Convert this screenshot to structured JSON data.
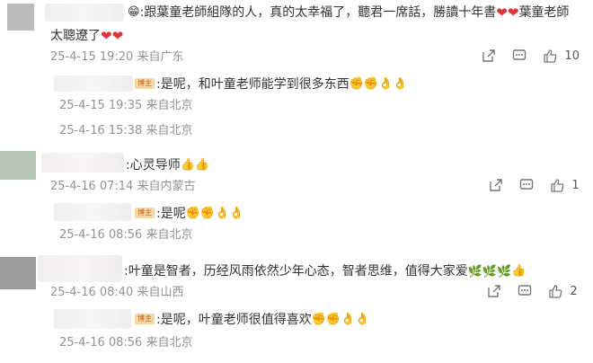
{
  "comments": [
    {
      "text_line1": ":跟葉童老師組隊的人，真的太幸福了，聽君一席話，勝讀十年書",
      "text_line1_tail": "葉童老師",
      "text_line2": "太聰遼了",
      "date": "25-4-15 19:20",
      "location": "来自广东",
      "likes": "10",
      "reply": {
        "badge": "博主",
        "text": ":是呢，和叶童老师能学到很多东西",
        "date": "25-4-15 19:35",
        "location": "来自北京"
      },
      "reply2": {
        "date": "25-4-16 15:38",
        "location": "来自北京"
      }
    },
    {
      "text": ":心灵导师",
      "date": "25-4-16 07:14",
      "location": "来自内蒙古",
      "likes": "1",
      "reply": {
        "badge": "博主",
        "text": ":是呢",
        "date": "25-4-16 08:56",
        "location": "来自北京"
      }
    },
    {
      "text": ":叶童是智者，历经风雨依然少年心态，智者思维，值得大家爱",
      "date": "25-4-16 08:40",
      "location": "来自山西",
      "likes": "2",
      "reply": {
        "badge": "博主",
        "text": ":是呢，叶童老师很值得喜欢",
        "date": "25-4-16 08:56",
        "location": "来自北京"
      }
    }
  ],
  "icons": [
    "share-icon",
    "comment-icon",
    "like-icon",
    "grin-emoji-icon",
    "heart-icon",
    "fist-emoji-icon",
    "ok-hand-emoji-icon",
    "thumbs-up-emoji-icon",
    "leaf-emoji-icon"
  ],
  "colors": {
    "meta": "#939393",
    "text": "#333333",
    "heart": "#e0363b",
    "badge_bg": "#f7d5a5"
  }
}
